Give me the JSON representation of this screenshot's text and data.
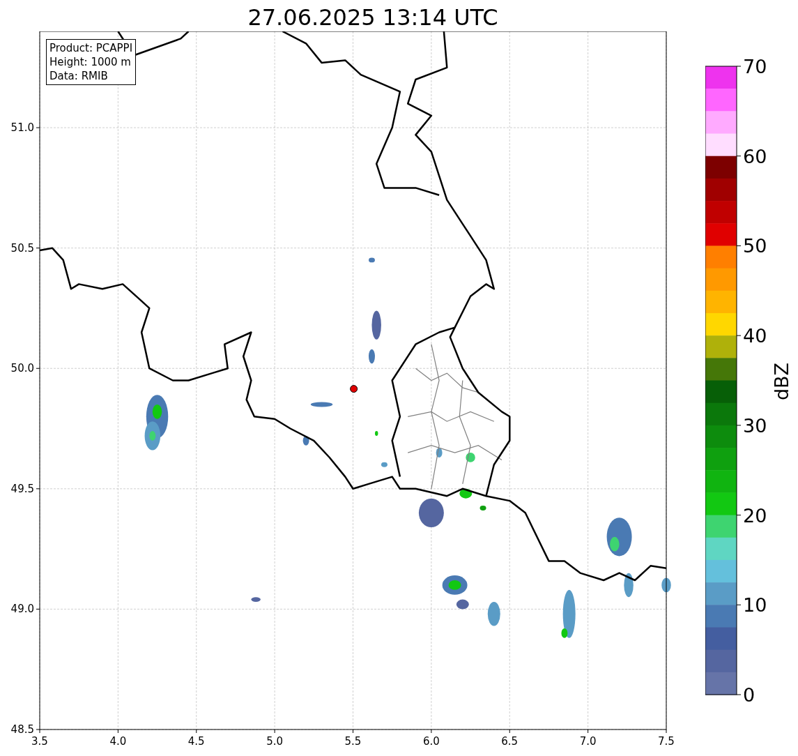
{
  "title": "27.06.2025 13:14 UTC",
  "info_box": [
    "Product: PCAPPI",
    "Height: 1000 m",
    "Data: RMIB"
  ],
  "axes": {
    "xticks": [
      "3.5",
      "4.0",
      "4.5",
      "5.0",
      "5.5",
      "6.0",
      "6.5",
      "7.0",
      "7.5"
    ],
    "yticks": [
      "51.0",
      "50.5",
      "50.0",
      "49.5",
      "49.0",
      "48.5"
    ]
  },
  "colorbar": {
    "label": "dBZ",
    "ticks": [
      "70",
      "60",
      "50",
      "40",
      "30",
      "20",
      "10",
      "0"
    ],
    "bins": [
      {
        "color": "#ee33ee"
      },
      {
        "color": "#ff66ff"
      },
      {
        "color": "#ffaaff"
      },
      {
        "color": "#ffddff"
      },
      {
        "color": "#7d0000"
      },
      {
        "color": "#a00000"
      },
      {
        "color": "#c00000"
      },
      {
        "color": "#e00000"
      },
      {
        "color": "#ff7f00"
      },
      {
        "color": "#ff9900"
      },
      {
        "color": "#ffb400"
      },
      {
        "color": "#ffd700"
      },
      {
        "color": "#afb10a"
      },
      {
        "color": "#457708"
      },
      {
        "color": "#075f07"
      },
      {
        "color": "#0b780b"
      },
      {
        "color": "#0d8c0d"
      },
      {
        "color": "#0fa00f"
      },
      {
        "color": "#10b410"
      },
      {
        "color": "#12c812"
      },
      {
        "color": "#3ed470"
      },
      {
        "color": "#5fd6c2"
      },
      {
        "color": "#64c0dc"
      },
      {
        "color": "#5a9cc6"
      },
      {
        "color": "#4a7ab3"
      },
      {
        "color": "#445ea0"
      },
      {
        "color": "#5566a0"
      },
      {
        "color": "#6674a8"
      }
    ]
  }
}
